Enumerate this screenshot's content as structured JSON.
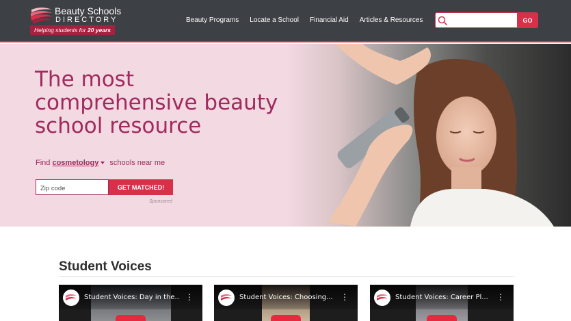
{
  "header": {
    "logo": {
      "title": "Beauty Schools",
      "subtitle": "DIRECTORY",
      "tagline_prefix": "Helping students for ",
      "tagline_bold": "20 years"
    },
    "nav": [
      {
        "label": "Beauty Programs"
      },
      {
        "label": "Locate a School"
      },
      {
        "label": "Financial Aid"
      },
      {
        "label": "Articles & Resources"
      }
    ],
    "search": {
      "placeholder": "",
      "value": "",
      "button_label": "GO"
    }
  },
  "hero": {
    "title_lines": [
      "The most",
      "comprehensive beauty",
      "school resource"
    ],
    "find_prefix": "Find",
    "program": "cosmetology",
    "find_suffix": "schools near me",
    "zip_placeholder": "Zip code",
    "cta_label": "GET MATCHED!",
    "sponsored": "Sponsored"
  },
  "student_voices": {
    "heading": "Student Voices",
    "videos": [
      {
        "title": "Student Voices: Day in the..."
      },
      {
        "title": "Student Voices: Choosing..."
      },
      {
        "title": "Student Voices: Career Pl..."
      }
    ]
  },
  "colors": {
    "header_bg": "#3d4044",
    "accent_red": "#d9304a",
    "hero_bg": "#f3d9e2",
    "hero_text": "#a12a5e"
  },
  "icons": [
    "logo-mark-icon",
    "search-icon",
    "caret-down-icon",
    "more-vert-icon",
    "play-icon"
  ]
}
